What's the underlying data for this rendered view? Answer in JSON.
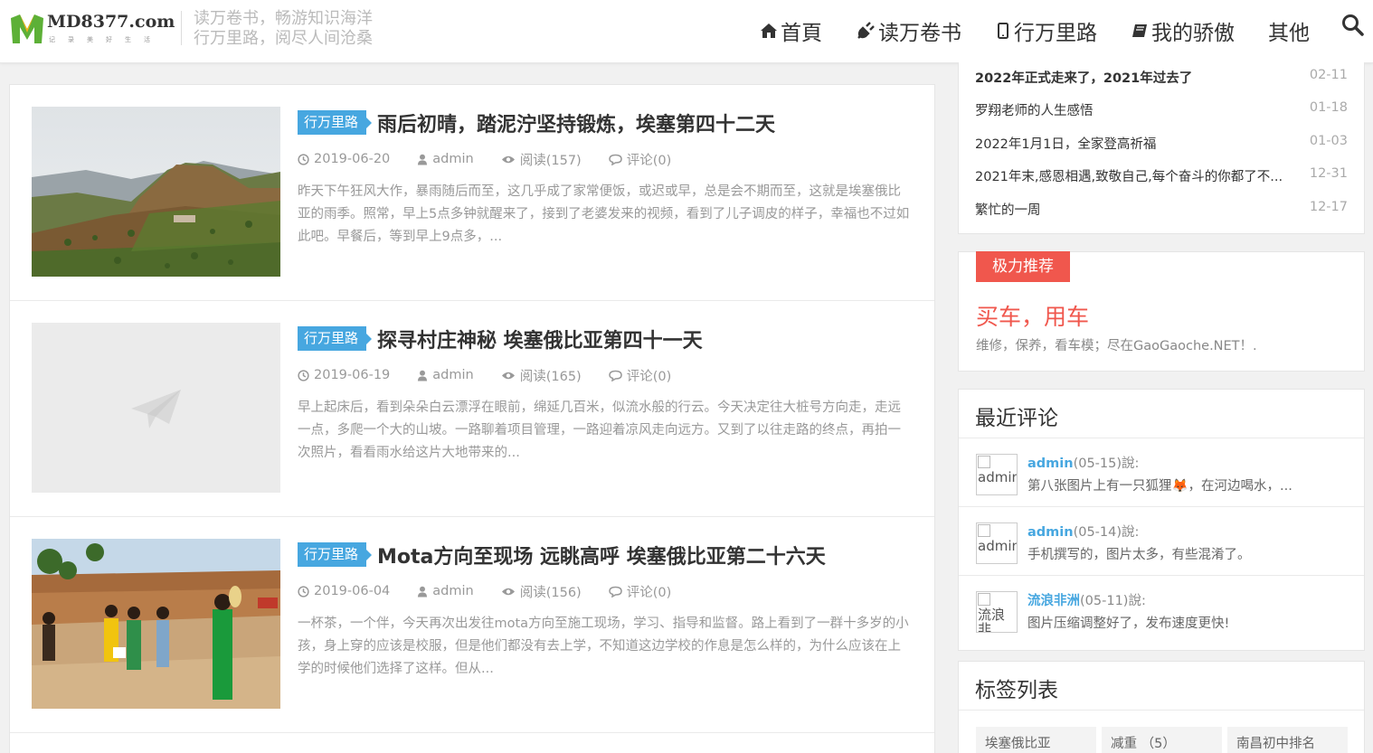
{
  "header": {
    "logo_text": "MD8377.com",
    "logo_sub": "记录美好生活",
    "slogan_line1": "读万卷书，畅游知识海洋",
    "slogan_line2": "行万里路，阅尽人间沧桑",
    "nav": [
      {
        "label": "首頁",
        "icon": "home-icon"
      },
      {
        "label": "读万卷书",
        "icon": "plug-icon"
      },
      {
        "label": "行万里路",
        "icon": "mobile-icon"
      },
      {
        "label": "我的骄傲",
        "icon": "book-icon"
      },
      {
        "label": "其他",
        "icon": ""
      }
    ],
    "search_icon": "search-icon"
  },
  "posts": [
    {
      "category": "行万里路",
      "title": "雨后初晴，踏泥泞坚持锻炼，埃塞第四十二天",
      "date": "2019-06-20",
      "author": "admin",
      "views": "阅读(157)",
      "comments": "评论(0)",
      "excerpt": "昨天下午狂风大作，暴雨随后而至，这几乎成了家常便饭，或迟或早，总是会不期而至，这就是埃塞俄比亚的雨季。照常，早上5点多钟就醒来了，接到了老婆发来的视频，看到了儿子调皮的样子，幸福也不过如此吧。早餐后，等到早上9点多，..."
    },
    {
      "category": "行万里路",
      "title": "探寻村庄神秘 埃塞俄比亚第四十一天",
      "date": "2019-06-19",
      "author": "admin",
      "views": "阅读(165)",
      "comments": "评论(0)",
      "excerpt": "早上起床后，看到朵朵白云漂浮在眼前，绵延几百米，似流水般的行云。今天决定往大桩号方向走，走远一点，多爬一个大的山坡。一路聊着项目管理，一路迎着凉风走向远方。又到了以往走路的终点，再拍一次照片，看看雨水给这片大地带来的..."
    },
    {
      "category": "行万里路",
      "title": "Mota方向至现场 远眺高呼 埃塞俄比亚第二十六天",
      "date": "2019-06-04",
      "author": "admin",
      "views": "阅读(156)",
      "comments": "评论(0)",
      "excerpt": "一杯茶，一个伴，今天再次出发往mota方向至施工现场，学习、指导和监督。路上看到了一群十多岁的小孩，身上穿的应该是校服，但是他们都没有去上学，不知道这边学校的作息是怎么样的，为什么应该在上学的时候他们选择了这样。但从..."
    }
  ],
  "recent_posts": [
    {
      "title": "2022年正式走来了，2021年过去了",
      "date": "02-11"
    },
    {
      "title": "罗翔老师的人生感悟",
      "date": "01-18"
    },
    {
      "title": "2022年1月1日，全家登高祈福",
      "date": "01-03"
    },
    {
      "title": "2021年末,感恩相遇,致敬自己,每个奋斗的你都了不...",
      "date": "12-31"
    },
    {
      "title": "繁忙的一周",
      "date": "12-17"
    }
  ],
  "recommend": {
    "badge": "极力推荐",
    "title": "买车，用车",
    "desc": "维修，保养，看车模；尽在GaoGaoche.NET！."
  },
  "recent_comments": {
    "heading": "最近评论",
    "items": [
      {
        "author": "admin",
        "when": "(05-15)說:",
        "avatar_alt": "admin",
        "text": "第八张图片上有一只狐狸🦊，在河边喝水，..."
      },
      {
        "author": "admin",
        "when": "(05-14)說:",
        "avatar_alt": "admin",
        "text": "手机撰写的，图片太多，有些混淆了。"
      },
      {
        "author": "流浪非洲",
        "when": "(05-11)說:",
        "avatar_alt": "流浪非",
        "text": "图片压缩调整好了，发布速度更快!"
      }
    ]
  },
  "tags": {
    "heading": "标签列表",
    "items": [
      "埃塞俄比亚",
      "减重 （5）",
      "南昌初中排名"
    ]
  },
  "colors": {
    "accent": "#47a7e0",
    "red": "#f0574d",
    "logo_green": "#5db037"
  }
}
